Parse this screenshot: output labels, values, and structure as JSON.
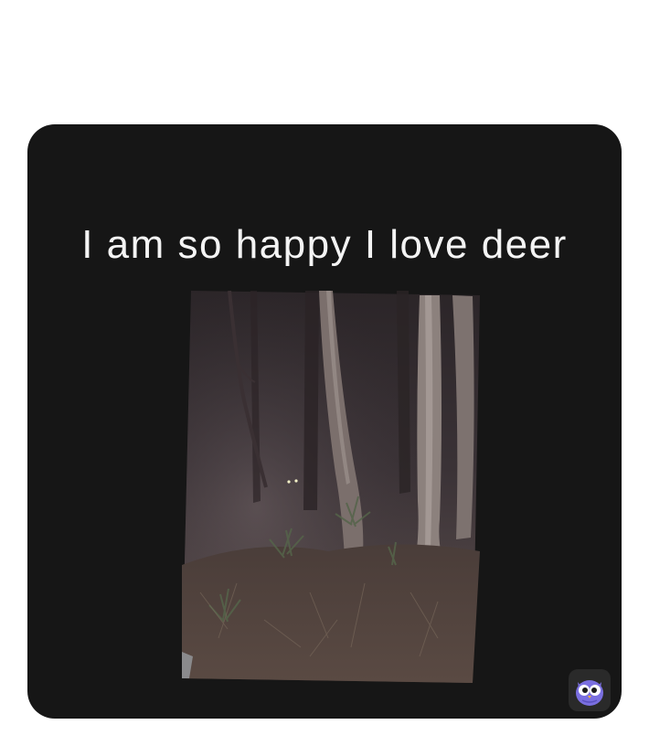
{
  "post": {
    "caption": "I am so happy I love deer"
  },
  "photo": {
    "description_icon": "forest-night-photo"
  },
  "watermark": {
    "icon": "owl-icon",
    "color": "#7a6fe0"
  }
}
